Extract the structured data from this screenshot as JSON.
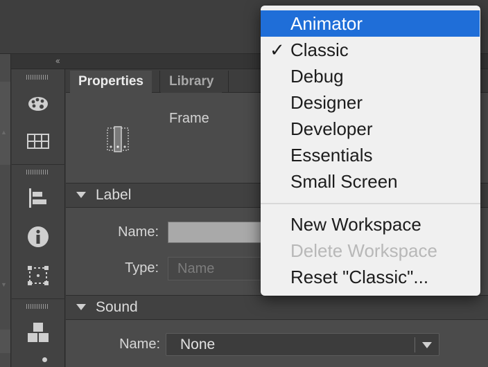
{
  "panel": {
    "collapse_glyph": "‹‹",
    "tabs": [
      {
        "label": "Properties",
        "active": true
      },
      {
        "label": "Library",
        "active": false
      }
    ],
    "frame_label": "Frame",
    "frame_icon": "keyframe-icon"
  },
  "label_section": {
    "title": "Label",
    "name_label": "Name:",
    "name_value": "",
    "type_label": "Type:",
    "type_value": "Name"
  },
  "sound_section": {
    "title": "Sound",
    "name_label": "Name:",
    "name_value": "None"
  },
  "tools": [
    "palette-icon",
    "grid-icon",
    "align-icon",
    "info-icon",
    "transform-icon",
    "components-icon"
  ],
  "workspace_menu": {
    "items": [
      {
        "label": "Animator",
        "highlighted": true,
        "checked": false,
        "enabled": true
      },
      {
        "label": "Classic",
        "highlighted": false,
        "checked": true,
        "enabled": true
      },
      {
        "label": "Debug",
        "highlighted": false,
        "checked": false,
        "enabled": true
      },
      {
        "label": "Designer",
        "highlighted": false,
        "checked": false,
        "enabled": true
      },
      {
        "label": "Developer",
        "highlighted": false,
        "checked": false,
        "enabled": true
      },
      {
        "label": "Essentials",
        "highlighted": false,
        "checked": false,
        "enabled": true
      },
      {
        "label": "Small Screen",
        "highlighted": false,
        "checked": false,
        "enabled": true
      },
      {
        "label": "New Workspace",
        "highlighted": false,
        "checked": false,
        "enabled": true
      },
      {
        "label": "Delete Workspace",
        "highlighted": false,
        "checked": false,
        "enabled": false
      },
      {
        "label": "Reset \"Classic\"...",
        "highlighted": false,
        "checked": false,
        "enabled": true
      }
    ],
    "check_glyph": "✓",
    "highlight_color": "#1f6ed8"
  },
  "colors": {
    "panel_bg": "#4b4b4b",
    "menu_bg": "#f0f0f0",
    "accent": "#1f6ed8"
  }
}
